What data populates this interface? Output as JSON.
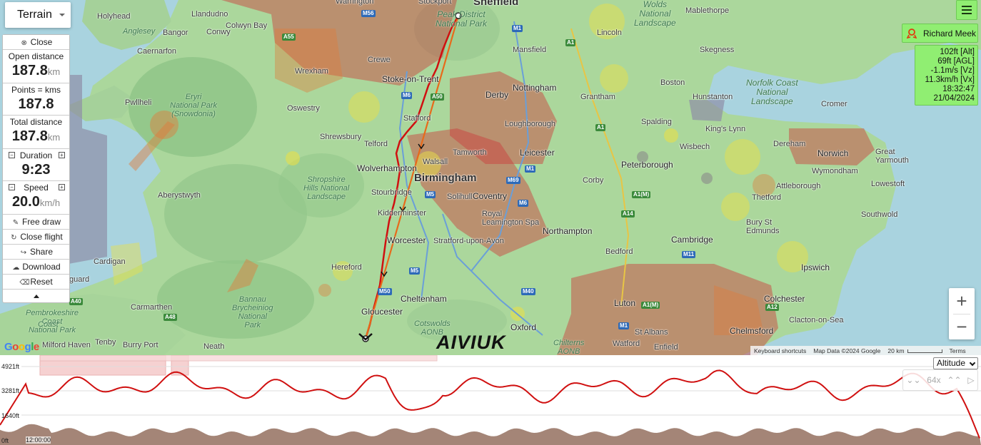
{
  "map": {
    "map_type": "Terrain",
    "places": [
      {
        "id": "sheffield",
        "text": "Sheffield",
        "cls": "place big"
      },
      {
        "id": "birmingham",
        "text": "Birmingham",
        "cls": "place big"
      },
      {
        "id": "wolverhampton",
        "text": "Wolverhampton",
        "cls": "place mid"
      },
      {
        "id": "coventry",
        "text": "Coventry",
        "cls": "place mid"
      },
      {
        "id": "leicester",
        "text": "Leicester",
        "cls": "place mid"
      },
      {
        "id": "nottingham",
        "text": "Nottingham",
        "cls": "place mid"
      },
      {
        "id": "derby",
        "text": "Derby",
        "cls": "place mid"
      },
      {
        "id": "peterborough",
        "text": "Peterborough",
        "cls": "place mid"
      },
      {
        "id": "northampton",
        "text": "Northampton",
        "cls": "place mid"
      },
      {
        "id": "cambridge",
        "text": "Cambridge",
        "cls": "place mid"
      },
      {
        "id": "norwich",
        "text": "Norwich",
        "cls": "place mid"
      },
      {
        "id": "ipswich",
        "text": "Ipswich",
        "cls": "place mid"
      },
      {
        "id": "colchester",
        "text": "Colchester",
        "cls": "place mid"
      },
      {
        "id": "chelmsford",
        "text": "Chelmsford",
        "cls": "place mid"
      },
      {
        "id": "luton",
        "text": "Luton",
        "cls": "place mid"
      },
      {
        "id": "oxford",
        "text": "Oxford",
        "cls": "place mid"
      },
      {
        "id": "gloucester",
        "text": "Gloucester",
        "cls": "place mid"
      },
      {
        "id": "cheltenham",
        "text": "Cheltenham",
        "cls": "place mid"
      },
      {
        "id": "worcester",
        "text": "Worcester",
        "cls": "place mid"
      },
      {
        "id": "stoke",
        "text": "Stoke-on-Trent",
        "cls": "place mid"
      },
      {
        "id": "lincoln",
        "text": "Lincoln",
        "cls": "place"
      },
      {
        "id": "boston",
        "text": "Boston",
        "cls": "place"
      },
      {
        "id": "grantham",
        "text": "Grantham",
        "cls": "place"
      },
      {
        "id": "spalding",
        "text": "Spalding",
        "cls": "place"
      },
      {
        "id": "kingslynn",
        "text": "King's Lynn",
        "cls": "place"
      },
      {
        "id": "wisbech",
        "text": "Wisbech",
        "cls": "place"
      },
      {
        "id": "thetford",
        "text": "Thetford",
        "cls": "place"
      },
      {
        "id": "bury",
        "text": "Bury St\nEdmunds",
        "cls": "place"
      },
      {
        "id": "bedford",
        "text": "Bedford",
        "cls": "place"
      },
      {
        "id": "corby",
        "text": "Corby",
        "cls": "place"
      },
      {
        "id": "mansfield",
        "text": "Mansfield",
        "cls": "place"
      },
      {
        "id": "skegness",
        "text": "Skegness",
        "cls": "place"
      },
      {
        "id": "mablethorpe",
        "text": "Mablethorpe",
        "cls": "place"
      },
      {
        "id": "hunstanton",
        "text": "Hunstanton",
        "cls": "place"
      },
      {
        "id": "cromer",
        "text": "Cromer",
        "cls": "place"
      },
      {
        "id": "dereham",
        "text": "Dereham",
        "cls": "place"
      },
      {
        "id": "wymondham",
        "text": "Wymondham",
        "cls": "place"
      },
      {
        "id": "attleborough",
        "text": "Attleborough",
        "cls": "place"
      },
      {
        "id": "lowestoft",
        "text": "Lowestoft",
        "cls": "place"
      },
      {
        "id": "southwold",
        "text": "Southwold",
        "cls": "place"
      },
      {
        "id": "greatyarmouth",
        "text": "Great\nYarmouth",
        "cls": "place"
      },
      {
        "id": "clacton",
        "text": "Clacton-on-Sea",
        "cls": "place"
      },
      {
        "id": "stalbans",
        "text": "St Albans",
        "cls": "place"
      },
      {
        "id": "watford",
        "text": "Watford",
        "cls": "place"
      },
      {
        "id": "enfield",
        "text": "Enfield",
        "cls": "place"
      },
      {
        "id": "stratford",
        "text": "Stratford-upon-Avon",
        "cls": "place"
      },
      {
        "id": "kidderminster",
        "text": "Kidderminster",
        "cls": "place"
      },
      {
        "id": "stourbridge",
        "text": "Stourbridge",
        "cls": "place"
      },
      {
        "id": "walsall",
        "text": "Walsall",
        "cls": "place"
      },
      {
        "id": "tamworth",
        "text": "Tamworth",
        "cls": "place"
      },
      {
        "id": "solihull",
        "text": "Solihull",
        "cls": "place"
      },
      {
        "id": "royalleam",
        "text": "Royal\nLeamington Spa",
        "cls": "place"
      },
      {
        "id": "loughborough",
        "text": "Loughborough",
        "cls": "place"
      },
      {
        "id": "stafford",
        "text": "Stafford",
        "cls": "place"
      },
      {
        "id": "telford",
        "text": "Telford",
        "cls": "place"
      },
      {
        "id": "shrewsbury",
        "text": "Shrewsbury",
        "cls": "place"
      },
      {
        "id": "oswestry",
        "text": "Oswestry",
        "cls": "place"
      },
      {
        "id": "crewe",
        "text": "Crewe",
        "cls": "place"
      },
      {
        "id": "wrexham",
        "text": "Wrexham",
        "cls": "place"
      },
      {
        "id": "hereford",
        "text": "Hereford",
        "cls": "place"
      },
      {
        "id": "aberystwyth",
        "text": "Aberystwyth",
        "cls": "place"
      },
      {
        "id": "cardigan",
        "text": "Cardigan",
        "cls": "place"
      },
      {
        "id": "carmarthen",
        "text": "Carmarthen",
        "cls": "place"
      },
      {
        "id": "tenby",
        "text": "Tenby",
        "cls": "place"
      },
      {
        "id": "neath",
        "text": "Neath",
        "cls": "place"
      },
      {
        "id": "burryport",
        "text": "Burry Port",
        "cls": "place"
      },
      {
        "id": "milfordhaven",
        "text": "Milford Haven",
        "cls": "place"
      },
      {
        "id": "pwllheli",
        "text": "Pwllheli",
        "cls": "place"
      },
      {
        "id": "caernarfon",
        "text": "Caernarfon",
        "cls": "place"
      },
      {
        "id": "bangor",
        "text": "Bangor",
        "cls": "place"
      },
      {
        "id": "holyhead",
        "text": "Holyhead",
        "cls": "place"
      },
      {
        "id": "conwy",
        "text": "Conwy",
        "cls": "place"
      },
      {
        "id": "llandudno",
        "text": "Llandudno",
        "cls": "place"
      },
      {
        "id": "colwynbay",
        "text": "Colwyn Bay",
        "cls": "place"
      },
      {
        "id": "stockport",
        "text": "Stockport",
        "cls": "place"
      },
      {
        "id": "warrington",
        "text": "Warrington",
        "cls": "place"
      },
      {
        "id": "guard",
        "text": "guard",
        "cls": "place"
      }
    ],
    "parks": [
      {
        "id": "peak",
        "text": "Peak District\nNational Park"
      },
      {
        "id": "wolds",
        "text": "Wolds\nNational\nLandscape"
      },
      {
        "id": "norfolk",
        "text": "Norfolk Coast\nNational\nLandscape"
      },
      {
        "id": "eryri",
        "text": "Eryri\nNational Park\n(Snowdonia)"
      },
      {
        "id": "shropshire",
        "text": "Shropshire\nHills National\nLandscape"
      },
      {
        "id": "bannau",
        "text": "Bannau\nBrycheiniog\nNational\nPark"
      },
      {
        "id": "cotswolds",
        "text": "Cotswolds\nAONB"
      },
      {
        "id": "chilterns",
        "text": "Chilterns\nAONB"
      },
      {
        "id": "pembs",
        "text": "Pembrokeshire\nCoast\nNational Park"
      },
      {
        "id": "anglesey",
        "text": "Anglesey"
      },
      {
        "id": "coast",
        "text": "Coast"
      }
    ],
    "roads": [
      {
        "id": "m1a",
        "text": "M1",
        "type": "m"
      },
      {
        "id": "m1b",
        "text": "M1",
        "type": "m"
      },
      {
        "id": "m1c",
        "text": "M1",
        "type": "m"
      },
      {
        "id": "m6a",
        "text": "M6",
        "type": "m"
      },
      {
        "id": "m6b",
        "text": "M6",
        "type": "m"
      },
      {
        "id": "m5a",
        "text": "M5",
        "type": "m"
      },
      {
        "id": "m5b",
        "text": "M5",
        "type": "m"
      },
      {
        "id": "m40",
        "text": "M40",
        "type": "m"
      },
      {
        "id": "m69",
        "text": "M69",
        "type": "m"
      },
      {
        "id": "m11",
        "text": "M11",
        "type": "m"
      },
      {
        "id": "m56",
        "text": "M56",
        "type": "m"
      },
      {
        "id": "m50",
        "text": "M50",
        "type": "m"
      },
      {
        "id": "a1a",
        "text": "A1",
        "type": "a"
      },
      {
        "id": "a1b",
        "text": "A1",
        "type": "a"
      },
      {
        "id": "a1m",
        "text": "A1(M)",
        "type": "a"
      },
      {
        "id": "a1m2",
        "text": "A1(M)",
        "type": "a"
      },
      {
        "id": "a14",
        "text": "A14",
        "type": "a"
      },
      {
        "id": "a12",
        "text": "A12",
        "type": "a"
      },
      {
        "id": "a55",
        "text": "A55",
        "type": "a"
      },
      {
        "id": "a48",
        "text": "A48",
        "type": "a"
      },
      {
        "id": "a50",
        "text": "A50",
        "type": "a"
      },
      {
        "id": "a40",
        "text": "A40",
        "type": "a"
      }
    ],
    "attribution": {
      "shortcuts": "Keyboard shortcuts",
      "data": "Map Data ©2024 Google",
      "scale": "20 km",
      "terms": "Terms"
    },
    "google_logo": "Google",
    "watermark": "AIVIUK",
    "zoom_in": "+",
    "zoom_out": "−"
  },
  "panel": {
    "close": "Close",
    "open_distance": {
      "label": "Open distance",
      "value": "187.8",
      "unit": "km"
    },
    "points": {
      "label": "Points = kms",
      "value": "187.8"
    },
    "total_distance": {
      "label": "Total distance",
      "value": "187.8",
      "unit": "km"
    },
    "duration": {
      "label": "Duration",
      "value": "9:23"
    },
    "speed": {
      "label": "Speed",
      "value": "20.0",
      "unit": "km/h"
    },
    "free_draw": "Free draw",
    "close_flight": "Close flight",
    "share": "Share",
    "download": "Download",
    "reset": "Reset"
  },
  "pilot": {
    "name": "Richard Meek"
  },
  "telemetry": {
    "alt": "102ft [Alt]",
    "agl": "69ft [AGL]",
    "vz": "-1.1m/s [Vz]",
    "vx": "11.3km/h [Vx]",
    "time": "18:32:47",
    "date": "21/04/2024"
  },
  "profile": {
    "selector": "Altitude",
    "y_labels": [
      "4921ft",
      "3281ft",
      "1640ft",
      "0ft"
    ],
    "x_label": "12:00:00",
    "speed_label": "64x",
    "colors": {
      "track": "#d01010",
      "ground": "#a48577"
    }
  }
}
